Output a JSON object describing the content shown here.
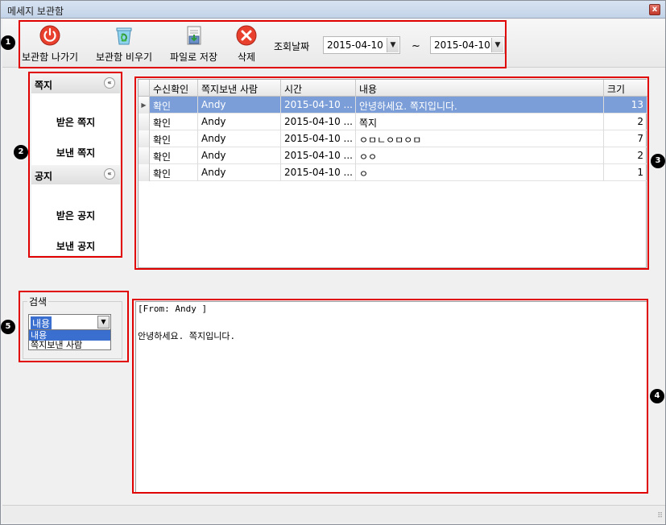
{
  "window": {
    "title": "메세지 보관함",
    "close": "x"
  },
  "toolbar": {
    "exit_label": "보관함 나가기",
    "empty_label": "보관함 비우기",
    "save_label": "파일로 저장",
    "delete_label": "삭제",
    "date_label": "조회날짜",
    "date_from": "2015-04-10",
    "date_to": "2015-04-10",
    "tilde": "~"
  },
  "markers": [
    "1",
    "2",
    "3",
    "4",
    "5"
  ],
  "sidebar": {
    "sections": [
      {
        "title": "쪽지",
        "items": [
          "받은 쪽지",
          "보낸 쪽지"
        ]
      },
      {
        "title": "공지",
        "items": [
          "받은 공지",
          "보낸 공지"
        ]
      }
    ],
    "collapse_glyph": "«"
  },
  "grid": {
    "columns": [
      "수신확인",
      "쪽지보낸 사람",
      "시간",
      "내용",
      "크기"
    ],
    "rows": [
      {
        "status": "확인",
        "sender": "Andy",
        "time": "2015-04-10 ...",
        "content": "안녕하세요. 쪽지입니다.",
        "size": "13",
        "selected": true
      },
      {
        "status": "확인",
        "sender": "Andy",
        "time": "2015-04-10 ...",
        "content": "쪽지",
        "size": "2",
        "selected": false
      },
      {
        "status": "확인",
        "sender": "Andy",
        "time": "2015-04-10 ...",
        "content": "ㅇㅁㄴㅇㅁㅇㅁ",
        "size": "7",
        "selected": false
      },
      {
        "status": "확인",
        "sender": "Andy",
        "time": "2015-04-10 ...",
        "content": "ㅇㅇ",
        "size": "2",
        "selected": false
      },
      {
        "status": "확인",
        "sender": "Andy",
        "time": "2015-04-10 ...",
        "content": "ㅇ",
        "size": "1",
        "selected": false
      }
    ]
  },
  "search": {
    "legend": "검색",
    "selected": "내용",
    "options": [
      "내용",
      "쪽지보낸 사람"
    ]
  },
  "viewer": {
    "from_line": "[From: Andy ]",
    "body": "안녕하세요. 쪽지입니다."
  },
  "colors": {
    "annotation": "#e10000",
    "selection": "#7b9ed8"
  }
}
